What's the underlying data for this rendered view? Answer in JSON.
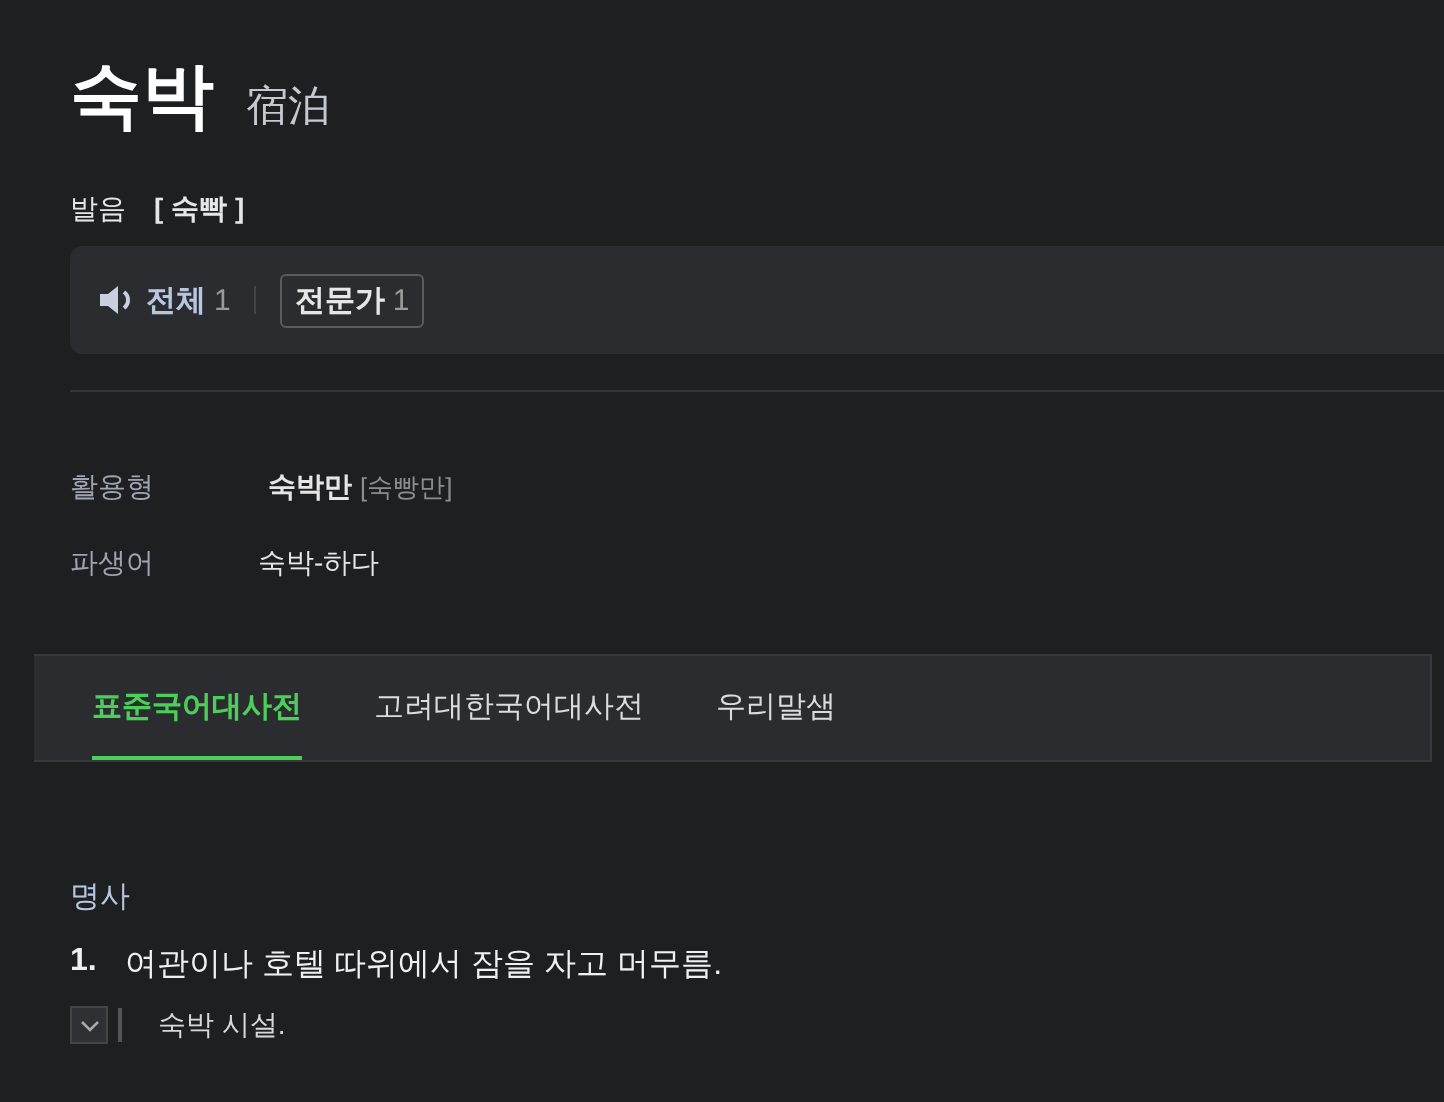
{
  "headword": "숙박",
  "hanja": "宿泊",
  "pronunciation": {
    "label": "발음",
    "value": "[ 숙빡 ]"
  },
  "audio": [
    {
      "kind": "speaker",
      "label": "전체",
      "count": "1"
    },
    {
      "kind": "boxed",
      "label": "전문가",
      "count": "1"
    }
  ],
  "forms": [
    {
      "label": "활용형",
      "value": "숙박만",
      "pron": "[숙빵만]"
    },
    {
      "label": "파생어",
      "value": "숙박-하다"
    }
  ],
  "tabs": [
    {
      "label": "표준국어대사전",
      "selected": true
    },
    {
      "label": "고려대한국어대사전",
      "selected": false
    },
    {
      "label": "우리말샘",
      "selected": false
    }
  ],
  "pos": "명사",
  "definitions": [
    {
      "number": "1.",
      "text": "여관이나 호텔 따위에서 잠을 자고 머무름.",
      "example": "숙박 시설.",
      "expanded": false
    }
  ]
}
